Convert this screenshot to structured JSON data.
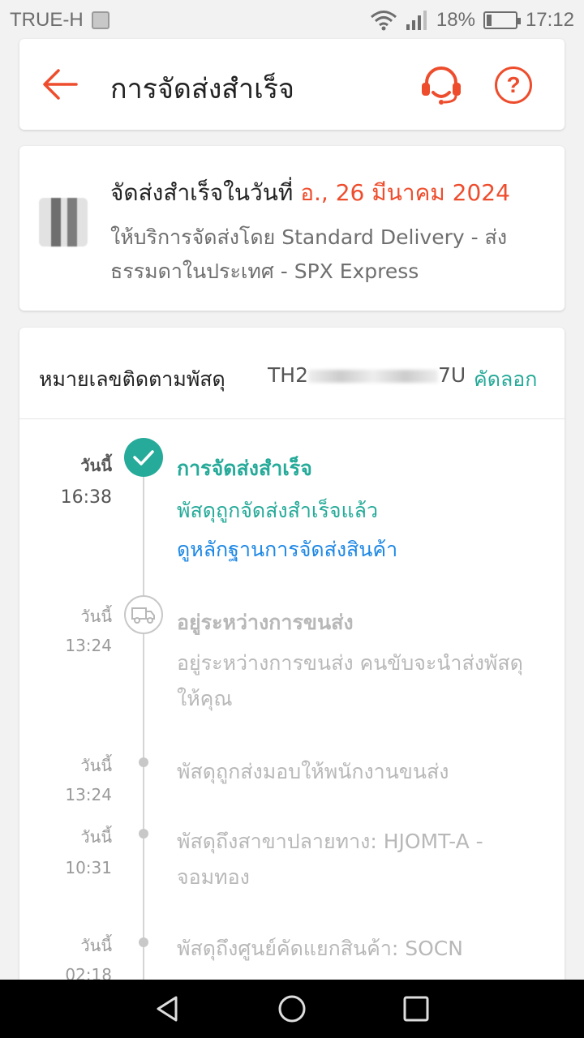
{
  "status_bar": {
    "carrier": "TRUE-H",
    "battery": "18%",
    "battery_level": 0.18,
    "time": "17:12"
  },
  "header": {
    "title": "การจัดส่งสำเร็จ",
    "back_icon": "arrow-left-icon",
    "support_icon": "headset-icon",
    "help_icon": "question-icon",
    "help_label": "?"
  },
  "summary": {
    "delivered_prefix": "จัดส่งสำเร็จในวันที่",
    "delivered_date": " อ., 26 มีนาคม 2024",
    "service": "ให้บริการจัดส่งโดย Standard Delivery - ส่งธรรมดาในประเทศ - SPX Express"
  },
  "tracking": {
    "label": "หมายเลขติดตามพัสดุ",
    "number_prefix": "TH2",
    "number_suffix": "7U",
    "copy_label": "คัดลอก"
  },
  "events": [
    {
      "date": "วันนี้",
      "time": "16:38",
      "title": "การจัดส่งสำเร็จ",
      "desc": "พัสดุถูกจัดส่งสำเร็จแล้ว",
      "link": "ดูหลักฐานการจัดส่งสินค้า"
    },
    {
      "date": "วันนี้",
      "time": "13:24",
      "title": "อยู่ระหว่างการขนส่ง",
      "desc": "อยู่ระหว่างการขนส่ง คนขับจะนำส่งพัสดุให้คุณ"
    },
    {
      "date": "วันนี้",
      "time": "13:24",
      "desc": "พัสดุถูกส่งมอบให้พนักงานขนส่ง"
    },
    {
      "date": "วันนี้",
      "time": "10:31",
      "desc": "พัสดุถึงสาขาปลายทาง: HJOMT-A - จอมทอง"
    },
    {
      "date": "วันนี้",
      "time": "02:18",
      "desc": "พัสดุถึงศูนย์คัดแยกสินค้า: SOCN"
    }
  ],
  "colors": {
    "accent": "#ee4d2d",
    "success": "#26aa99",
    "link": "#1e88e5",
    "muted": "#b8b8b8"
  }
}
